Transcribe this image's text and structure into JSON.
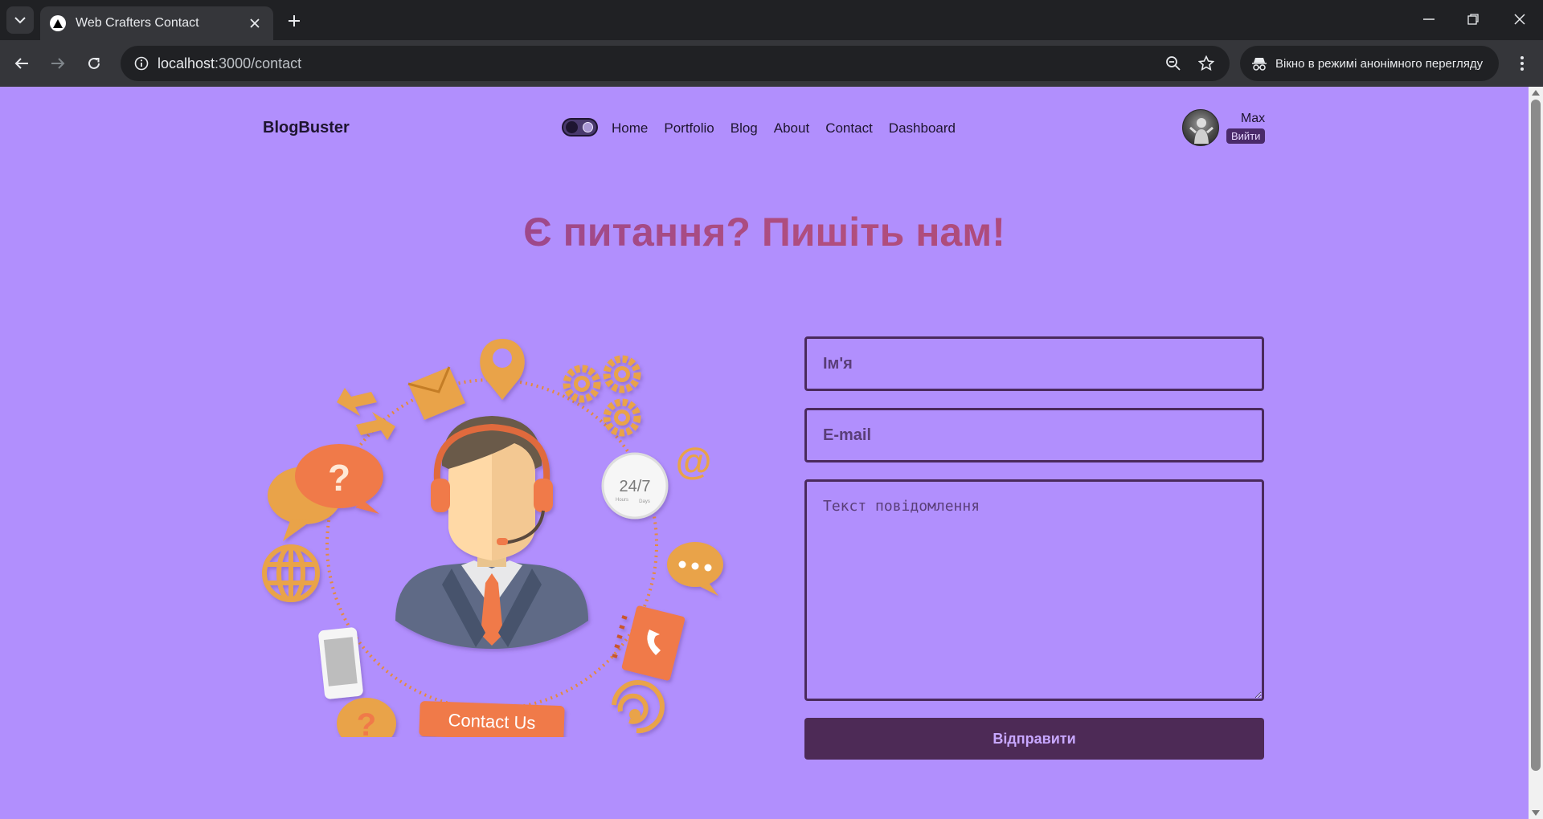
{
  "browser": {
    "tab_title": "Web Crafters Contact",
    "url_host": "localhost",
    "url_path": ":3000/contact",
    "incognito_label": "Вікно в режимі анонімного перегляду"
  },
  "site": {
    "logo": "BlogBuster",
    "nav": [
      "Home",
      "Portfolio",
      "Blog",
      "About",
      "Contact",
      "Dashboard"
    ],
    "user": {
      "name": "Max",
      "logout_label": "Вийти"
    }
  },
  "contact": {
    "title": "Є питання? Пишіть нам!",
    "illustration": {
      "button_label": "Contact Us",
      "clock_label": "24/7",
      "clock_sub_left": "Hours",
      "clock_sub_right": "Days",
      "at_symbol": "@",
      "question_mark": "?"
    },
    "form": {
      "name_placeholder": "Ім'я",
      "email_placeholder": "E-mail",
      "message_placeholder": "Текст повідомлення",
      "submit_label": "Відправити"
    }
  },
  "colors": {
    "page_bg": "#b18ffd",
    "accent_dark": "#4d2a56",
    "illustration_orange": "#e9a348",
    "illustration_coral": "#f07a4a"
  }
}
